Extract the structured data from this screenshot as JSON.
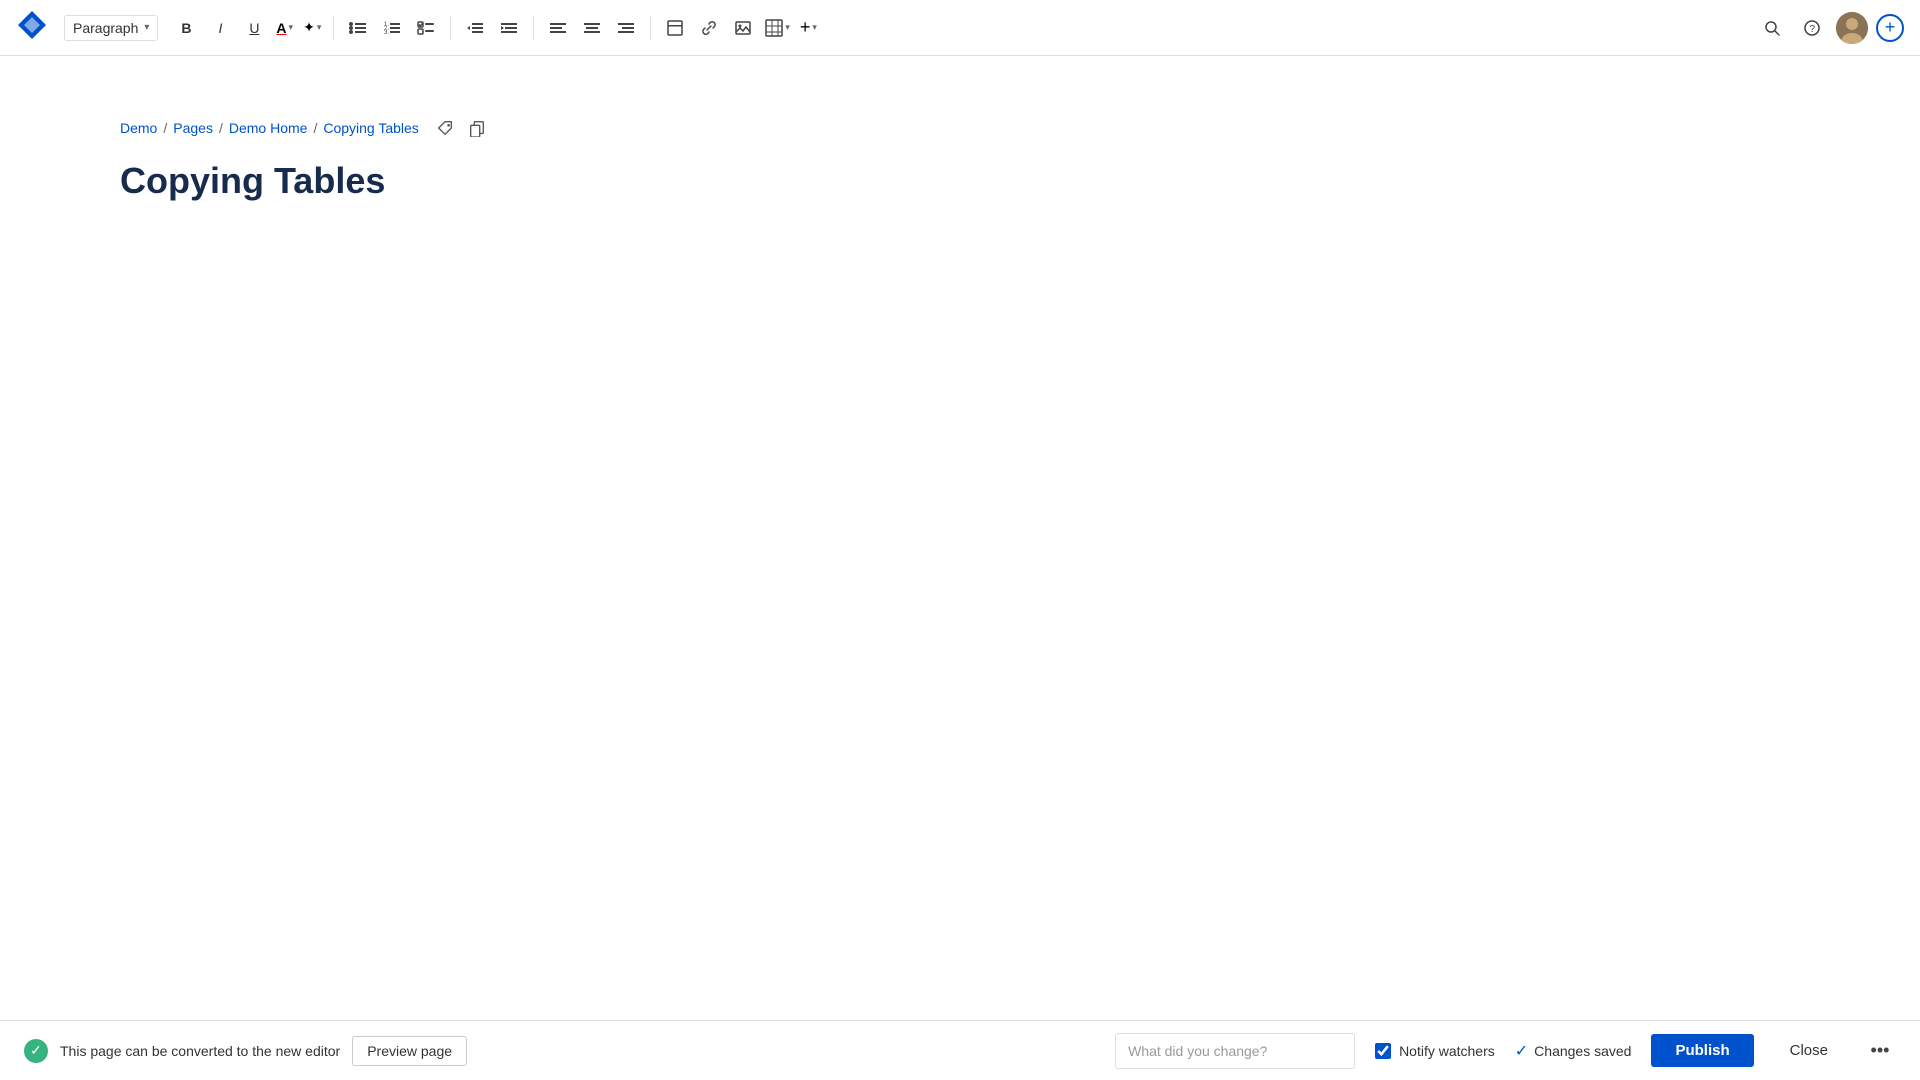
{
  "app": {
    "logo_label": "Confluence"
  },
  "toolbar": {
    "paragraph_label": "Paragraph",
    "bold": "B",
    "italic": "I",
    "underline": "U",
    "text_color_label": "A",
    "highlight_label": "✦",
    "bullet_list": "☰",
    "numbered_list": "☰",
    "task_list": "☑",
    "outdent": "⇐",
    "indent": "⇒",
    "align_left": "≡",
    "align_center": "≡",
    "align_right": "≡",
    "insert_panel": "▣",
    "insert_link": "🔗",
    "insert_image": "🖼",
    "insert_table": "⊞",
    "insert_more": "+"
  },
  "breadcrumb": {
    "items": [
      {
        "label": "Demo",
        "href": "#"
      },
      {
        "label": "Pages",
        "href": "#"
      },
      {
        "label": "Demo Home",
        "href": "#"
      },
      {
        "label": "Copying Tables",
        "href": "#"
      }
    ],
    "separators": [
      "/",
      "/",
      "/"
    ]
  },
  "page": {
    "title": "Copying Tables"
  },
  "bottom_bar": {
    "convert_notice": "This page can be converted to the new editor",
    "preview_label": "Preview page",
    "change_placeholder": "What did you change?",
    "notify_label": "Notify watchers",
    "changes_saved_label": "Changes saved",
    "publish_label": "Publish",
    "close_label": "Close"
  }
}
